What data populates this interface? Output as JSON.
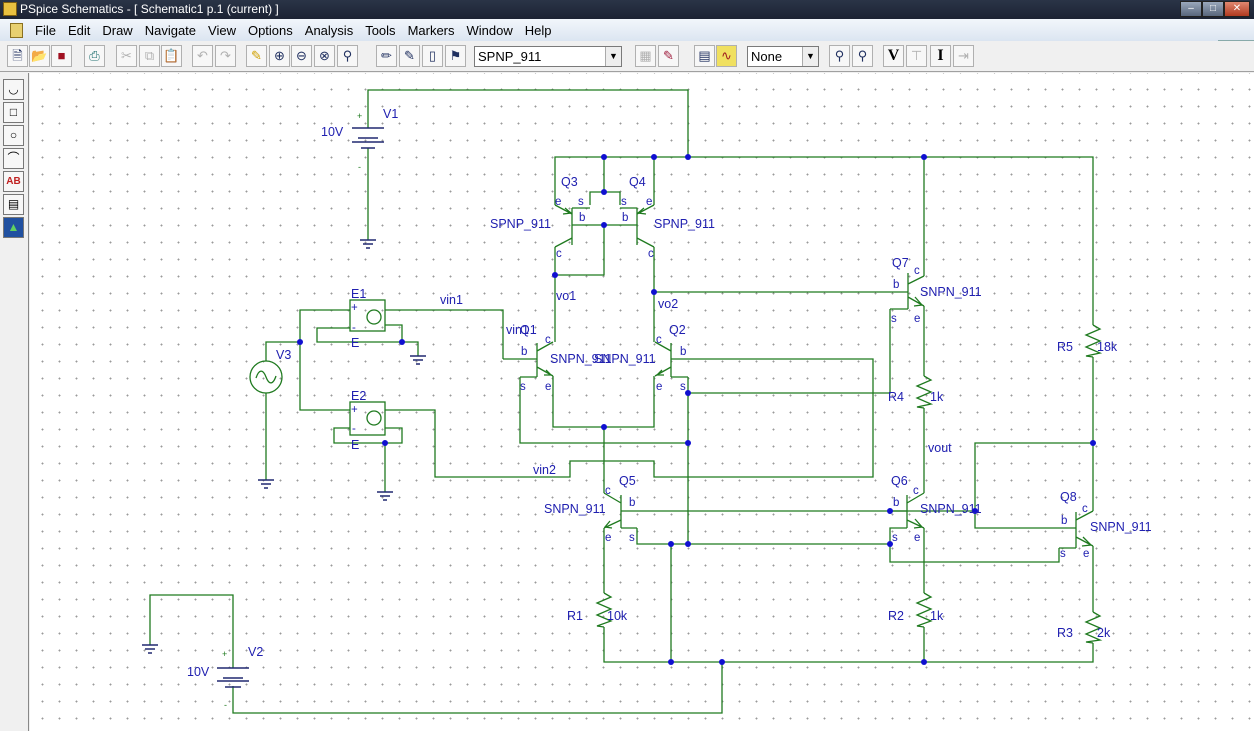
{
  "window": {
    "title": "PSpice Schematics - [ Schematic1  p.1 (current) ]"
  },
  "menu": [
    "File",
    "Edit",
    "Draw",
    "Navigate",
    "View",
    "Options",
    "Analysis",
    "Tools",
    "Markers",
    "Window",
    "Help"
  ],
  "toolbar": {
    "part_combo": "SPNP_911",
    "marker_combo": "None",
    "buttons": [
      "new-icon",
      "open-icon",
      "save-icon",
      "print-icon",
      "cut-icon",
      "copy-icon",
      "paste-icon",
      "undo-icon",
      "redo-icon",
      "highlight-icon",
      "zoom-in-icon",
      "zoom-out-icon",
      "zoom-area-icon",
      "zoom-fit-icon",
      "draw-wire-icon",
      "draw-bus-icon",
      "draw-block-icon",
      "get-part-icon",
      "edit-symbol-icon",
      "edit-attributes-icon",
      "setup-analysis-icon",
      "simulate-icon",
      "voltage-probe-icon",
      "current-probe-icon",
      "enable-voltage-display-icon",
      "voltage-display-icon",
      "enable-current-display-icon",
      "current-display-icon"
    ],
    "bias_v": "V",
    "bias_i": "I"
  },
  "palette": [
    "arc-icon",
    "box-icon",
    "circle-icon",
    "polyline-icon",
    "text-icon",
    "text-box-icon",
    "insert-picture-icon"
  ],
  "schematic": {
    "sources": [
      {
        "name": "V1",
        "value": "10V",
        "plus": "+",
        "minus": "-"
      },
      {
        "name": "V2",
        "value": "10V",
        "plus": "+",
        "minus": "-"
      },
      {
        "name": "V3"
      }
    ],
    "vcvs": [
      {
        "name": "E1",
        "plus": "+",
        "minus": "-",
        "gain_label": "E"
      },
      {
        "name": "E2",
        "plus": "+",
        "minus": "-",
        "gain_label": "E"
      }
    ],
    "transistors": [
      {
        "name": "Q1",
        "model": "SNPN_911",
        "pins": {
          "c": "c",
          "b": "b",
          "e": "e",
          "s": "s"
        }
      },
      {
        "name": "Q2",
        "model": "SNPN_911",
        "pins": {
          "c": "c",
          "b": "b",
          "e": "e",
          "s": "s"
        }
      },
      {
        "name": "Q3",
        "model": "SPNP_911",
        "pins": {
          "c": "c",
          "b": "b",
          "e": "e",
          "s": "s"
        }
      },
      {
        "name": "Q4",
        "model": "SPNP_911",
        "pins": {
          "c": "c",
          "b": "b",
          "e": "e",
          "s": "s"
        }
      },
      {
        "name": "Q5",
        "model": "SNPN_911",
        "pins": {
          "c": "c",
          "b": "b",
          "e": "e",
          "s": "s"
        }
      },
      {
        "name": "Q6",
        "model": "SNPN_911",
        "pins": {
          "c": "c",
          "b": "b",
          "e": "e",
          "s": "s"
        }
      },
      {
        "name": "Q7",
        "model": "SNPN_911",
        "pins": {
          "c": "c",
          "b": "b",
          "e": "e",
          "s": "s"
        }
      },
      {
        "name": "Q8",
        "model": "SNPN_911",
        "pins": {
          "c": "c",
          "b": "b",
          "e": "e",
          "s": "s"
        }
      }
    ],
    "resistors": [
      {
        "name": "R1",
        "value": "10k"
      },
      {
        "name": "R2",
        "value": "1k"
      },
      {
        "name": "R3",
        "value": "2k"
      },
      {
        "name": "R4",
        "value": "1k"
      },
      {
        "name": "R5",
        "value": "18k"
      }
    ],
    "nets": {
      "vin1": "vin1",
      "vin1_q1": "vin1",
      "vin2": "vin2",
      "vo1": "vo1",
      "vo2": "vo2",
      "vout": "vout"
    },
    "colors": {
      "wire": "#1f7a1f",
      "label": "#2020b0",
      "junction": "#1010d0"
    }
  }
}
